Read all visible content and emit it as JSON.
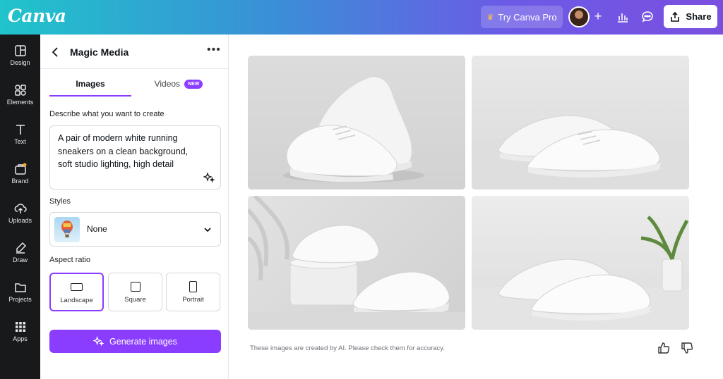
{
  "topbar": {
    "logo": "Canva",
    "try_pro_label": "Try Canva Pro",
    "share_label": "Share",
    "icons": [
      "crown-icon",
      "avatar",
      "plus-icon",
      "analytics-icon",
      "comment-icon",
      "share-icon"
    ]
  },
  "rail": {
    "items": [
      {
        "label": "Design",
        "icon": "design-icon"
      },
      {
        "label": "Elements",
        "icon": "elements-icon"
      },
      {
        "label": "Text",
        "icon": "text-icon"
      },
      {
        "label": "Brand",
        "icon": "brand-icon"
      },
      {
        "label": "Uploads",
        "icon": "uploads-icon"
      },
      {
        "label": "Draw",
        "icon": "draw-icon"
      },
      {
        "label": "Projects",
        "icon": "projects-icon"
      },
      {
        "label": "Apps",
        "icon": "apps-icon"
      }
    ]
  },
  "panel": {
    "title": "Magic Media",
    "tabs": [
      {
        "label": "Images",
        "active": true
      },
      {
        "label": "Videos",
        "badge": "NEW"
      }
    ],
    "describe_label": "Describe what you want to create",
    "prompt_lines": [
      "A pair of modern white running",
      "sneakers on a clean background,",
      "soft studio lighting, high detail"
    ],
    "styles_label": "Styles",
    "styles_value": "None",
    "aspect_label": "Aspect ratio",
    "aspect_options": [
      {
        "label": "Landscape",
        "selected": true
      },
      {
        "label": "Square",
        "selected": false
      },
      {
        "label": "Portrait",
        "selected": false
      }
    ],
    "generate_label": "Generate images"
  },
  "canvas": {
    "disclaimer": "These images are created by AI. Please check them for accuracy."
  },
  "colors": {
    "accent": "#8b3dff",
    "rail_bg": "#18191b",
    "header_gradient": [
      "#20c4cb",
      "#7b4fe0"
    ]
  }
}
